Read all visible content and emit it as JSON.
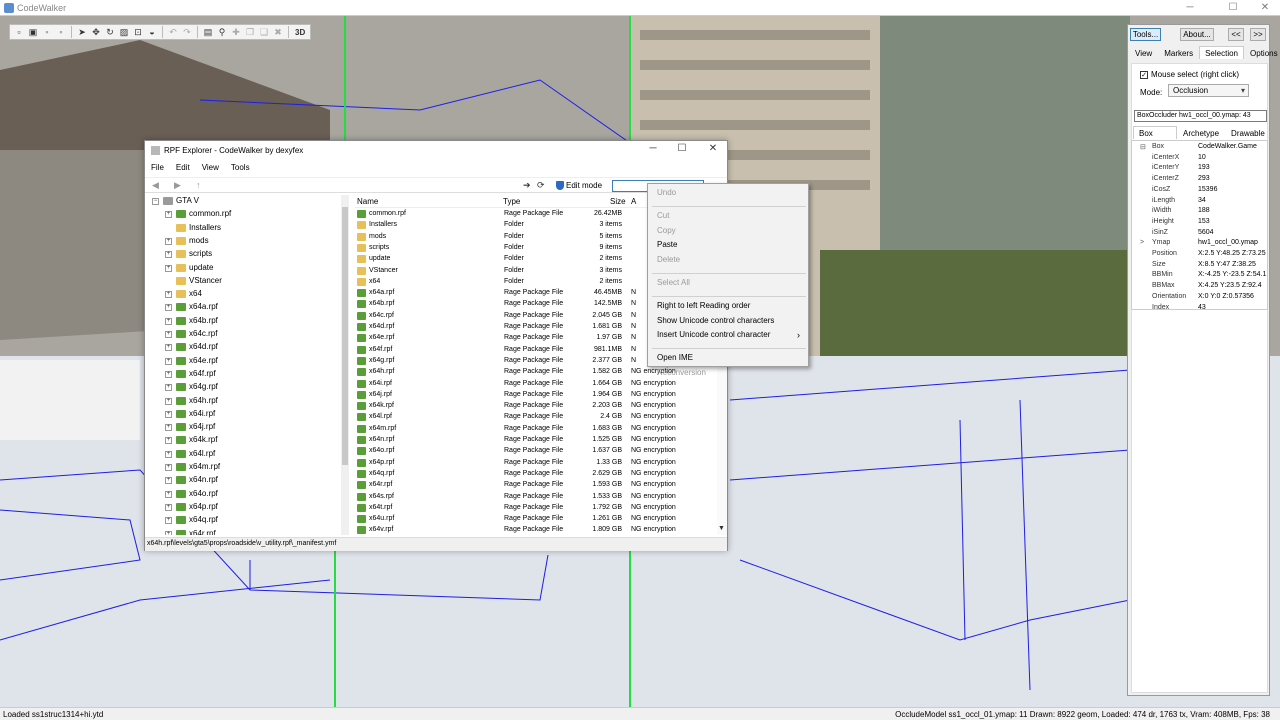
{
  "app": {
    "title": "CodeWalker"
  },
  "toolbar": {
    "mode_3d": "3D"
  },
  "right_panel": {
    "tools_label": "Tools...",
    "about_label": "About...",
    "prev_label": "<<",
    "next_label": ">>",
    "tabs": [
      "View",
      "Markers",
      "Selection",
      "Options"
    ],
    "mouse_select_label": "Mouse select (right click)",
    "mode_label": "Mode:",
    "mode_value": "Occlusion",
    "selected_name": "BoxOccluder hw1_occl_00.ymap: 43",
    "sub_tabs": [
      "Box Occluder",
      "Archetype",
      "Drawable"
    ],
    "props": [
      {
        "k": "Box",
        "v": "CodeWalker.Game",
        "exp": "⊟"
      },
      {
        "k": "iCenterX",
        "v": "10"
      },
      {
        "k": "iCenterY",
        "v": "193"
      },
      {
        "k": "iCenterZ",
        "v": "293"
      },
      {
        "k": "iCosZ",
        "v": "15396"
      },
      {
        "k": "iLength",
        "v": "34"
      },
      {
        "k": "iWidth",
        "v": "188"
      },
      {
        "k": "iHeight",
        "v": "153"
      },
      {
        "k": "iSinZ",
        "v": "5604"
      },
      {
        "k": "Ymap",
        "v": "hw1_occl_00.ymap",
        "exp": ">"
      },
      {
        "k": "Position",
        "v": "X:2.5 Y:48.25 Z:73.25"
      },
      {
        "k": "Size",
        "v": "X:8.5 Y:47 Z:38.25"
      },
      {
        "k": "BBMin",
        "v": "X:-4.25 Y:-23.5 Z:54.1"
      },
      {
        "k": "BBMax",
        "v": "X:4.25 Y:23.5 Z:92.4"
      },
      {
        "k": "Orientation",
        "v": "X:0 Y:0 Z:0.57356"
      },
      {
        "k": "Index",
        "v": "43"
      }
    ]
  },
  "explorer": {
    "title": "RPF Explorer - CodeWalker by dexyfex",
    "menu": [
      "File",
      "Edit",
      "View",
      "Tools"
    ],
    "edit_mode_label": "Edit mode",
    "tree_root": "GTA V",
    "tree": [
      {
        "label": "common.rpf",
        "type": "rpf",
        "pm": "+"
      },
      {
        "label": "Installers",
        "type": "folder",
        "pm": ""
      },
      {
        "label": "mods",
        "type": "folder",
        "pm": "+"
      },
      {
        "label": "scripts",
        "type": "folder",
        "pm": "+"
      },
      {
        "label": "update",
        "type": "folder",
        "pm": "+"
      },
      {
        "label": "VStancer",
        "type": "folder",
        "pm": ""
      },
      {
        "label": "x64",
        "type": "folder",
        "pm": "+"
      },
      {
        "label": "x64a.rpf",
        "type": "rpf",
        "pm": "+"
      },
      {
        "label": "x64b.rpf",
        "type": "rpf",
        "pm": "+"
      },
      {
        "label": "x64c.rpf",
        "type": "rpf",
        "pm": "+"
      },
      {
        "label": "x64d.rpf",
        "type": "rpf",
        "pm": "+"
      },
      {
        "label": "x64e.rpf",
        "type": "rpf",
        "pm": "+"
      },
      {
        "label": "x64f.rpf",
        "type": "rpf",
        "pm": "+"
      },
      {
        "label": "x64g.rpf",
        "type": "rpf",
        "pm": "+"
      },
      {
        "label": "x64h.rpf",
        "type": "rpf",
        "pm": "+"
      },
      {
        "label": "x64i.rpf",
        "type": "rpf",
        "pm": "+"
      },
      {
        "label": "x64j.rpf",
        "type": "rpf",
        "pm": "+"
      },
      {
        "label": "x64k.rpf",
        "type": "rpf",
        "pm": "+"
      },
      {
        "label": "x64l.rpf",
        "type": "rpf",
        "pm": "+"
      },
      {
        "label": "x64m.rpf",
        "type": "rpf",
        "pm": "+"
      },
      {
        "label": "x64n.rpf",
        "type": "rpf",
        "pm": "+"
      },
      {
        "label": "x64o.rpf",
        "type": "rpf",
        "pm": "+"
      },
      {
        "label": "x64p.rpf",
        "type": "rpf",
        "pm": "+"
      },
      {
        "label": "x64q.rpf",
        "type": "rpf",
        "pm": "+"
      },
      {
        "label": "x64r.rpf",
        "type": "rpf",
        "pm": "+"
      }
    ],
    "columns": {
      "name": "Name",
      "type": "Type",
      "size": "Size",
      "attr": "A"
    },
    "files": [
      {
        "name": "common.rpf",
        "type": "Rage Package File",
        "size": "26.42MB",
        "attr": "",
        "icon": "rpf"
      },
      {
        "name": "Installers",
        "type": "Folder",
        "size": "3 items",
        "attr": "",
        "icon": "folder"
      },
      {
        "name": "mods",
        "type": "Folder",
        "size": "5 items",
        "attr": "",
        "icon": "folder"
      },
      {
        "name": "scripts",
        "type": "Folder",
        "size": "9 items",
        "attr": "",
        "icon": "folder"
      },
      {
        "name": "update",
        "type": "Folder",
        "size": "2 items",
        "attr": "",
        "icon": "folder"
      },
      {
        "name": "VStancer",
        "type": "Folder",
        "size": "3 items",
        "attr": "",
        "icon": "folder"
      },
      {
        "name": "x64",
        "type": "Folder",
        "size": "2 items",
        "attr": "",
        "icon": "folder"
      },
      {
        "name": "x64a.rpf",
        "type": "Rage Package File",
        "size": "46.45MB",
        "attr": "N",
        "icon": "rpf"
      },
      {
        "name": "x64b.rpf",
        "type": "Rage Package File",
        "size": "142.5MB",
        "attr": "N",
        "icon": "rpf"
      },
      {
        "name": "x64c.rpf",
        "type": "Rage Package File",
        "size": "2.045 GB",
        "attr": "N",
        "icon": "rpf"
      },
      {
        "name": "x64d.rpf",
        "type": "Rage Package File",
        "size": "1.681 GB",
        "attr": "N",
        "icon": "rpf"
      },
      {
        "name": "x64e.rpf",
        "type": "Rage Package File",
        "size": "1.97 GB",
        "attr": "N",
        "icon": "rpf"
      },
      {
        "name": "x64f.rpf",
        "type": "Rage Package File",
        "size": "981.1MB",
        "attr": "N",
        "icon": "rpf"
      },
      {
        "name": "x64g.rpf",
        "type": "Rage Package File",
        "size": "2.377 GB",
        "attr": "N",
        "icon": "rpf"
      },
      {
        "name": "x64h.rpf",
        "type": "Rage Package File",
        "size": "1.582 GB",
        "attr": "NG encryption",
        "icon": "rpf"
      },
      {
        "name": "x64i.rpf",
        "type": "Rage Package File",
        "size": "1.664 GB",
        "attr": "NG encryption",
        "icon": "rpf"
      },
      {
        "name": "x64j.rpf",
        "type": "Rage Package File",
        "size": "1.964 GB",
        "attr": "NG encryption",
        "icon": "rpf"
      },
      {
        "name": "x64k.rpf",
        "type": "Rage Package File",
        "size": "2.203 GB",
        "attr": "NG encryption",
        "icon": "rpf"
      },
      {
        "name": "x64l.rpf",
        "type": "Rage Package File",
        "size": "2.4 GB",
        "attr": "NG encryption",
        "icon": "rpf"
      },
      {
        "name": "x64m.rpf",
        "type": "Rage Package File",
        "size": "1.683 GB",
        "attr": "NG encryption",
        "icon": "rpf"
      },
      {
        "name": "x64n.rpf",
        "type": "Rage Package File",
        "size": "1.525 GB",
        "attr": "NG encryption",
        "icon": "rpf"
      },
      {
        "name": "x64o.rpf",
        "type": "Rage Package File",
        "size": "1.637 GB",
        "attr": "NG encryption",
        "icon": "rpf"
      },
      {
        "name": "x64p.rpf",
        "type": "Rage Package File",
        "size": "1.33 GB",
        "attr": "NG encryption",
        "icon": "rpf"
      },
      {
        "name": "x64q.rpf",
        "type": "Rage Package File",
        "size": "2.629 GB",
        "attr": "NG encryption",
        "icon": "rpf"
      },
      {
        "name": "x64r.rpf",
        "type": "Rage Package File",
        "size": "1.593 GB",
        "attr": "NG encryption",
        "icon": "rpf"
      },
      {
        "name": "x64s.rpf",
        "type": "Rage Package File",
        "size": "1.533 GB",
        "attr": "NG encryption",
        "icon": "rpf"
      },
      {
        "name": "x64t.rpf",
        "type": "Rage Package File",
        "size": "1.792 GB",
        "attr": "NG encryption",
        "icon": "rpf"
      },
      {
        "name": "x64u.rpf",
        "type": "Rage Package File",
        "size": "1.261 GB",
        "attr": "NG encryption",
        "icon": "rpf"
      },
      {
        "name": "x64v.rpf",
        "type": "Rage Package File",
        "size": "1.809 GB",
        "attr": "NG encryption",
        "icon": "rpf"
      }
    ],
    "status": "x64h.rpf\\levels\\gta5\\props\\roadside\\v_utility.rpf\\_manifest.ymf"
  },
  "context_menu": [
    {
      "label": "Undo",
      "disabled": true
    },
    {
      "sep": true
    },
    {
      "label": "Cut",
      "disabled": true
    },
    {
      "label": "Copy",
      "disabled": true
    },
    {
      "label": "Paste",
      "disabled": false
    },
    {
      "label": "Delete",
      "disabled": true
    },
    {
      "sep": true
    },
    {
      "label": "Select All",
      "disabled": true
    },
    {
      "sep": true
    },
    {
      "label": "Right to left Reading order",
      "disabled": false
    },
    {
      "label": "Show Unicode control characters",
      "disabled": false
    },
    {
      "label": "Insert Unicode control character",
      "disabled": false,
      "submenu": "›"
    },
    {
      "sep": true
    },
    {
      "label": "Open IME",
      "disabled": false
    },
    {
      "label": "Reconversion",
      "disabled": true
    }
  ],
  "statusbar": {
    "left": "Loaded ss1struc1314+hi.ytd",
    "right": "OccludeModel ss1_occl_01.ymap: 11  Drawn: 8922 geom, Loaded: 474 dr, 1763 tx, Vram: 408MB, Fps: 38"
  }
}
